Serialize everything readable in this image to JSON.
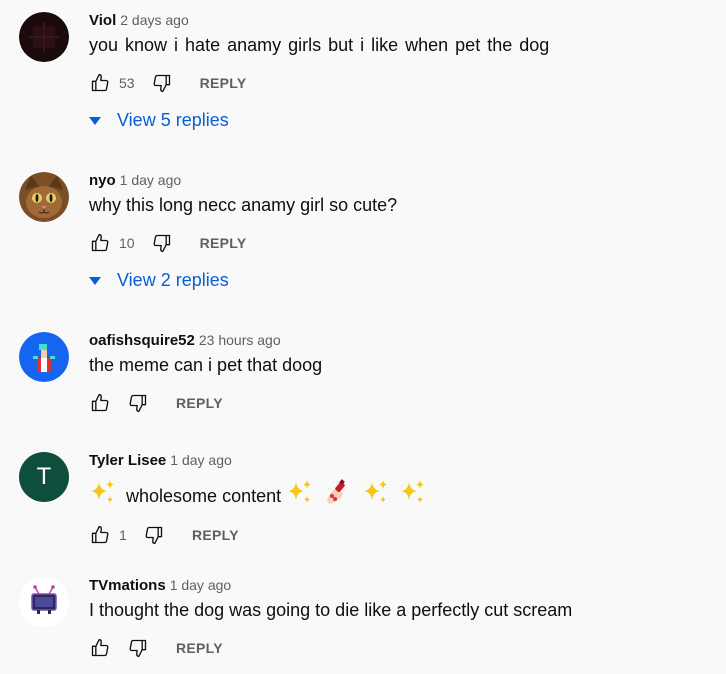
{
  "comments": [
    {
      "author": "Viol",
      "time": "2 days ago",
      "text": "you know i hate anamy girls but i like  when pet  the dog",
      "likes": "53",
      "reply_label": "REPLY",
      "view_replies": "View 5 replies",
      "avatar_color": "#1a0a0c"
    },
    {
      "author": "nyo",
      "time": "1 day ago",
      "text": "why this long necc anamy girl so cute?",
      "likes": "10",
      "reply_label": "REPLY",
      "view_replies": "View 2 replies",
      "avatar_color": "#8a5a2c"
    },
    {
      "author": "oafishsquire52",
      "time": "23 hours ago",
      "text": "the meme can i pet that doog",
      "likes": "",
      "reply_label": "REPLY",
      "avatar_color": "#1565f0"
    },
    {
      "author": "Tyler Lisee",
      "time": "1 day ago",
      "text": "wholesome content",
      "likes": "1",
      "reply_label": "REPLY",
      "avatar_letter": "T",
      "avatar_color": "#0d4f3c"
    },
    {
      "author": "TVmations",
      "time": "1 day ago",
      "text": "I thought the dog was going to die like a perfectly cut scream",
      "likes": "",
      "reply_label": "REPLY",
      "avatar_color": "#ffffff"
    }
  ],
  "colors": {
    "link_blue": "#065fd4",
    "secondary_text": "#606060",
    "background": "#f9f9f9"
  },
  "icons": {
    "like": "thumb-up-icon",
    "dislike": "thumb-down-icon",
    "expand": "caret-down-icon",
    "sparkles": "sparkles-emoji",
    "nail_polish": "nail-polish-emoji"
  }
}
